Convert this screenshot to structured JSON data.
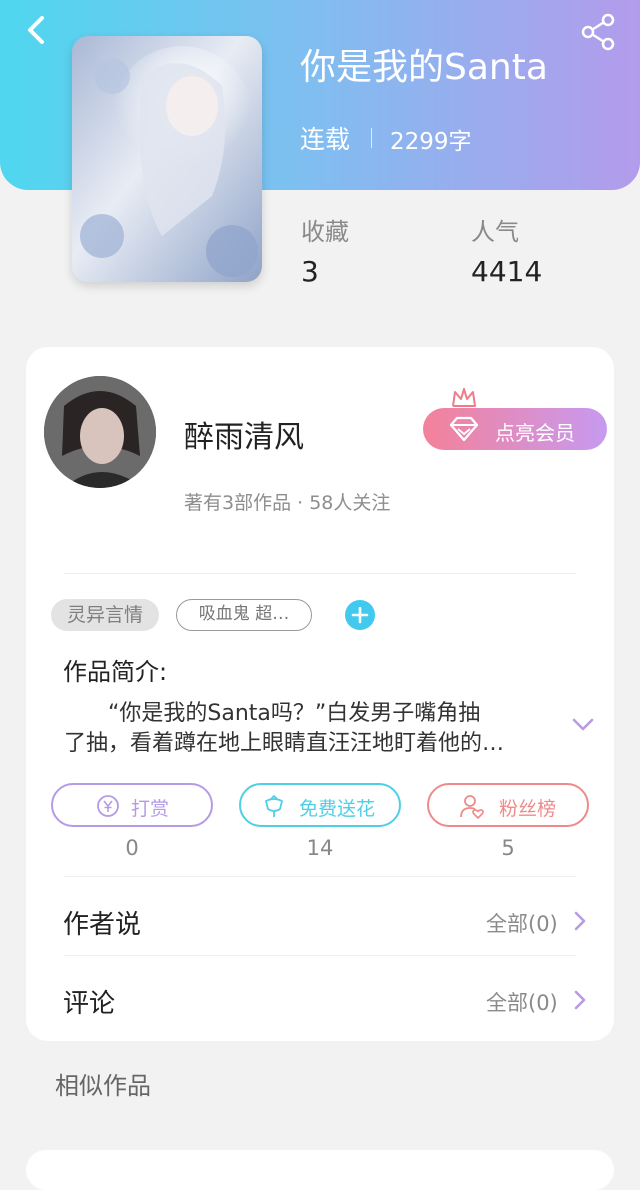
{
  "book": {
    "title": "你是我的Santa",
    "status": "连载",
    "word_count": "2299字",
    "stats": [
      {
        "label": "收藏",
        "value": "3"
      },
      {
        "label": "人气",
        "value": "4414"
      }
    ]
  },
  "author": {
    "name": "醉雨清风",
    "meta": "著有3部作品 · 58人关注",
    "vip_label": "点亮会员"
  },
  "tags": {
    "genre": "灵异言情",
    "keyword": "吸血鬼 超…"
  },
  "intro": {
    "title": "作品简介:",
    "line1": "“你是我的Santa吗？”白发男子嘴角抽",
    "line2": "了抽，看着蹲在地上眼睛直汪汪地盯着他的…"
  },
  "actions": [
    {
      "label": "打赏",
      "count": "0",
      "color": "#b59be6"
    },
    {
      "label": "免费送花",
      "count": "14",
      "color": "#4fcfe6"
    },
    {
      "label": "粉丝榜",
      "count": "5",
      "color": "#ef8a8a"
    }
  ],
  "sections": [
    {
      "title": "作者说",
      "more": "全部(0)"
    },
    {
      "title": "评论",
      "more": "全部(0)"
    }
  ],
  "similar": {
    "title": "相似作品"
  },
  "icons": {
    "back": "back-arrow-icon",
    "share": "share-icon",
    "vip": "diamond-icon",
    "crown": "crown-icon",
    "add_tag": "plus-icon",
    "expand": "chevron-down-icon",
    "reward": "yen-coin-icon",
    "flower": "flower-icon",
    "fans": "user-heart-icon",
    "more": "chevron-right-icon"
  }
}
